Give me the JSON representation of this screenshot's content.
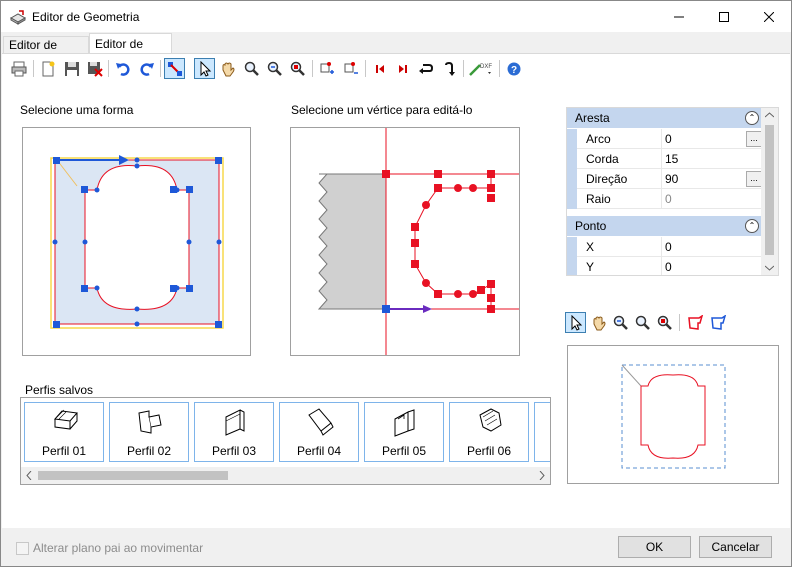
{
  "window": {
    "title": "Editor de Geometria",
    "controls": [
      "minimize",
      "maximize",
      "close"
    ]
  },
  "tabs": [
    {
      "label": "Editor de Forma",
      "active": false
    },
    {
      "label": "Editor de Perfil",
      "active": true
    }
  ],
  "toolbar": {
    "icons": [
      "print-icon",
      "new-icon",
      "save-icon",
      "delete-save-icon",
      "undo-icon",
      "redo-icon",
      "snap-icon",
      "select-icon",
      "pan-icon",
      "zoom-icon",
      "zoom-in-out-icon",
      "zoom-window-icon",
      "add-vertex-icon",
      "remove-vertex-icon",
      "first-icon",
      "last-icon",
      "reverse-icon",
      "flip-icon",
      "dxf-icon",
      "help-icon"
    ]
  },
  "labels": {
    "shape_section": "Selecione uma forma",
    "vertex_section": "Selecione um vértice para editá-lo",
    "saved_profiles": "Perfis salvos"
  },
  "properties": {
    "categories": [
      {
        "name": "Aresta",
        "rows": [
          {
            "name": "Arco",
            "value": "0",
            "has_button": true,
            "disabled": false
          },
          {
            "name": "Corda",
            "value": "15",
            "has_button": false,
            "disabled": false
          },
          {
            "name": "Direção",
            "value": "90",
            "has_button": true,
            "disabled": false
          },
          {
            "name": "Raio",
            "value": "0",
            "has_button": false,
            "disabled": true
          }
        ]
      },
      {
        "name": "Ponto",
        "rows": [
          {
            "name": "X",
            "value": "0",
            "has_button": false,
            "disabled": false
          },
          {
            "name": "Y",
            "value": "0",
            "has_button": false,
            "disabled": false
          }
        ]
      }
    ]
  },
  "saved_profiles": [
    "Perfil 01",
    "Perfil 02",
    "Perfil 03",
    "Perfil 04",
    "Perfil 05",
    "Perfil 06"
  ],
  "footer": {
    "checkbox_label": "Alterar plano pai ao movimentar",
    "checkbox_checked": false,
    "ok": "OK",
    "cancel": "Cancelar"
  },
  "colors": {
    "accent_blue": "#1e58d8",
    "profile_red": "#e81123",
    "selection_fill": "#dbe6f4",
    "yellow_frame": "#f7d94c",
    "category_bg": "#c4d6ee"
  }
}
